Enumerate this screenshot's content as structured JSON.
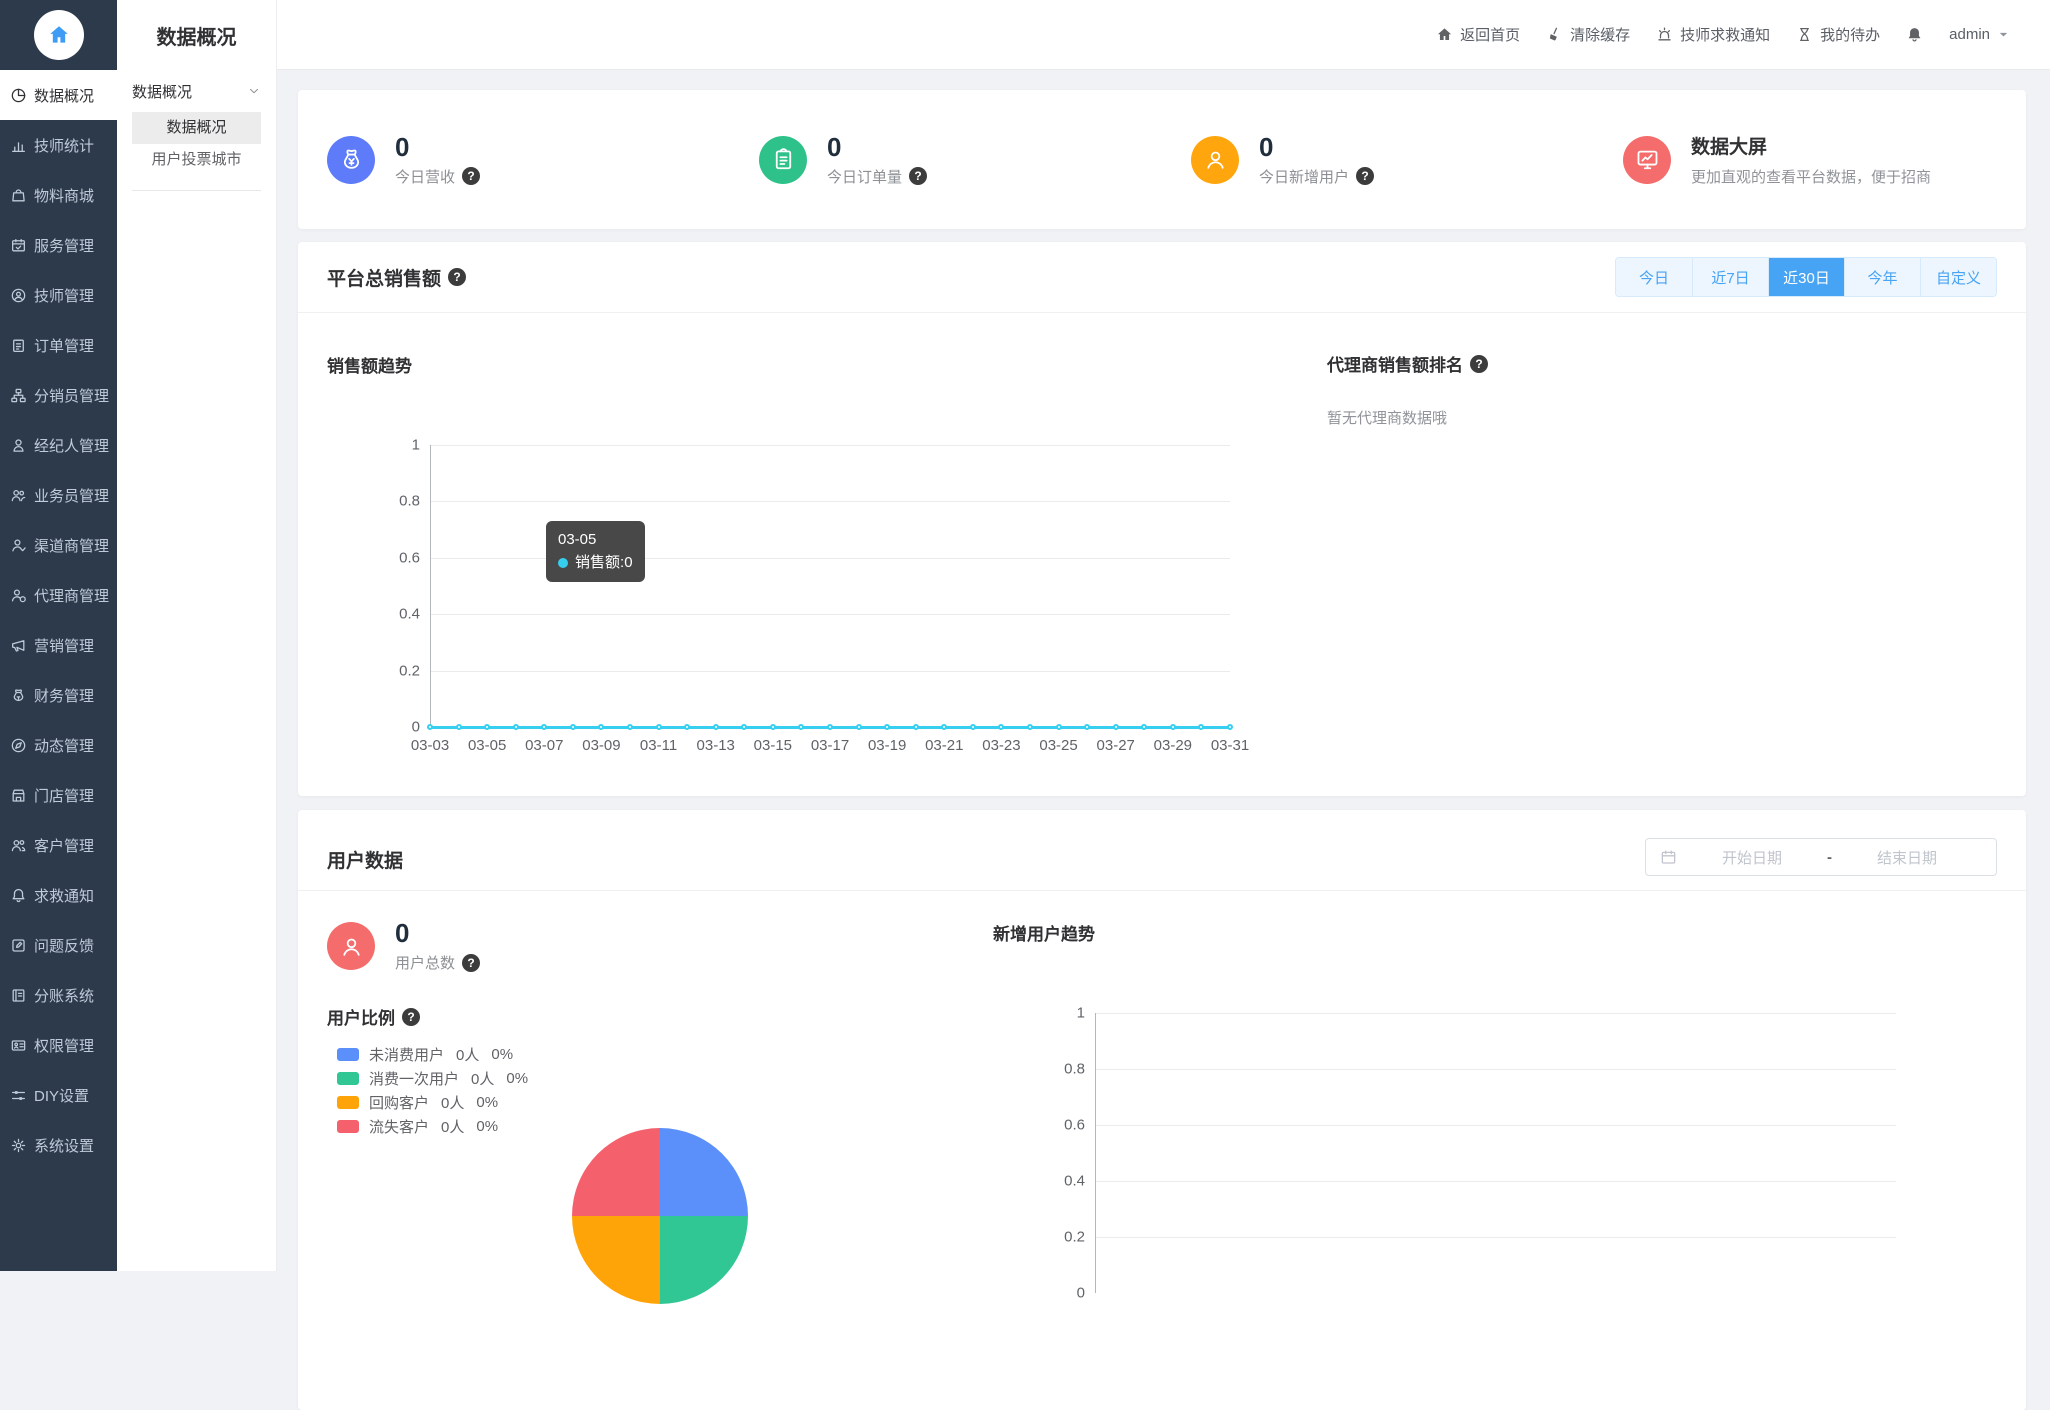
{
  "icons": {
    "help": "?"
  },
  "sidebar": {
    "items": [
      {
        "label": "数据概况",
        "icon": "pie-chart",
        "active": true
      },
      {
        "label": "技师统计",
        "icon": "bar-chart"
      },
      {
        "label": "物料商城",
        "icon": "shopping-bag"
      },
      {
        "label": "服务管理",
        "icon": "calendar-check"
      },
      {
        "label": "技师管理",
        "icon": "headset-person"
      },
      {
        "label": "订单管理",
        "icon": "clipboard"
      },
      {
        "label": "分销员管理",
        "icon": "org-tree"
      },
      {
        "label": "经纪人管理",
        "icon": "person-badge"
      },
      {
        "label": "业务员管理",
        "icon": "people"
      },
      {
        "label": "渠道商管理",
        "icon": "person-check"
      },
      {
        "label": "代理商管理",
        "icon": "person-circle"
      },
      {
        "label": "营销管理",
        "icon": "megaphone"
      },
      {
        "label": "财务管理",
        "icon": "money-bag-outline"
      },
      {
        "label": "动态管理",
        "icon": "compass"
      },
      {
        "label": "门店管理",
        "icon": "storefront"
      },
      {
        "label": "客户管理",
        "icon": "people-group"
      },
      {
        "label": "求救通知",
        "icon": "bell"
      },
      {
        "label": "问题反馈",
        "icon": "edit-square"
      },
      {
        "label": "分账系统",
        "icon": "ledger"
      },
      {
        "label": "权限管理",
        "icon": "id-card"
      },
      {
        "label": "DIY设置",
        "icon": "sliders"
      },
      {
        "label": "系统设置",
        "icon": "gear"
      }
    ]
  },
  "submenu": {
    "title": "数据概况",
    "group_label": "数据概况",
    "items": [
      {
        "label": "数据概况",
        "active": true
      },
      {
        "label": "用户投票城市"
      }
    ]
  },
  "header": {
    "nav": [
      {
        "label": "返回首页",
        "icon": "home"
      },
      {
        "label": "清除缓存",
        "icon": "broom"
      },
      {
        "label": "技师求救通知",
        "icon": "siren"
      },
      {
        "label": "我的待办",
        "icon": "hourglass"
      }
    ],
    "username": "admin"
  },
  "stats": {
    "cards": [
      {
        "icon": "money-bag",
        "color": "#5e7cf9",
        "value": "0",
        "label": "今日营收"
      },
      {
        "icon": "clipboard-stat",
        "color": "#2ec28a",
        "value": "0",
        "label": "今日订单量"
      },
      {
        "icon": "user-stat",
        "color": "#ffa60e",
        "value": "0",
        "label": "今日新增用户"
      }
    ],
    "bigscreen": {
      "icon": "monitor-chart",
      "color": "#f56c6c",
      "title": "数据大屏",
      "subtitle": "更加直观的查看平台数据，便于招商"
    }
  },
  "sales": {
    "title": "平台总销售额",
    "tabs": [
      {
        "label": "今日"
      },
      {
        "label": "近7日"
      },
      {
        "label": "近30日",
        "active": true
      },
      {
        "label": "今年"
      },
      {
        "label": "自定义"
      }
    ],
    "trend_title": "销售额趋势",
    "tooltip": {
      "date": "03-05",
      "label": "销售额",
      "separator": ": ",
      "value": "0"
    },
    "ranking_title": "代理商销售额排名",
    "ranking_empty": "暂无代理商数据哦"
  },
  "users": {
    "title": "用户数据",
    "date_range": {
      "start_placeholder": "开始日期",
      "separator": "-",
      "end_placeholder": "结束日期"
    },
    "total": {
      "value": "0",
      "label": "用户总数",
      "color": "#f56c6c",
      "icon": "user-stat"
    },
    "ratio_title": "用户比例",
    "legend": [
      {
        "name": "未消费用户",
        "count": "0人",
        "pct": "0%",
        "color": "#5b8ff9"
      },
      {
        "name": "消费一次用户",
        "count": "0人",
        "pct": "0%",
        "color": "#30c795"
      },
      {
        "name": "回购客户",
        "count": "0人",
        "pct": "0%",
        "color": "#ffa408"
      },
      {
        "name": "流失客户",
        "count": "0人",
        "pct": "0%",
        "color": "#f4606c"
      }
    ],
    "trend_title": "新增用户趋势"
  },
  "chart_data": [
    {
      "type": "line",
      "title": "销售额趋势",
      "x": [
        "03-03",
        "03-04",
        "03-05",
        "03-06",
        "03-07",
        "03-08",
        "03-09",
        "03-10",
        "03-11",
        "03-12",
        "03-13",
        "03-14",
        "03-15",
        "03-16",
        "03-17",
        "03-18",
        "03-19",
        "03-20",
        "03-21",
        "03-22",
        "03-23",
        "03-24",
        "03-25",
        "03-26",
        "03-27",
        "03-28",
        "03-29",
        "03-30",
        "03-31"
      ],
      "x_label_every": 2,
      "series": [
        {
          "name": "销售额",
          "values": [
            0,
            0,
            0,
            0,
            0,
            0,
            0,
            0,
            0,
            0,
            0,
            0,
            0,
            0,
            0,
            0,
            0,
            0,
            0,
            0,
            0,
            0,
            0,
            0,
            0,
            0,
            0,
            0,
            0
          ]
        }
      ],
      "ylim": [
        0,
        1
      ],
      "yticks": [
        0,
        0.2,
        0.4,
        0.6,
        0.8,
        1
      ],
      "line_color": "#36cff0",
      "grid": true,
      "legend_position": "none",
      "tooltip_point": {
        "x": "03-05",
        "value": 0
      }
    },
    {
      "type": "pie",
      "title": "用户比例",
      "labels": [
        "未消费用户",
        "消费一次用户",
        "回购客户",
        "流失客户"
      ],
      "values": [
        0,
        0,
        0,
        0
      ],
      "colors": [
        "#5b8ff9",
        "#30c795",
        "#ffa408",
        "#f4606c"
      ],
      "note": "all values 0 - rendered as four equal quarters",
      "legend_position": "left"
    },
    {
      "type": "line",
      "title": "新增用户趋势",
      "series": [
        {
          "name": "新增用户",
          "values": []
        }
      ],
      "ylim": [
        0,
        1
      ],
      "yticks": [
        0,
        0.2,
        0.4,
        0.6,
        0.8,
        1
      ],
      "grid": true,
      "note": "plot area cut off at bottom of viewport; only axes/gridlines visible"
    }
  ]
}
